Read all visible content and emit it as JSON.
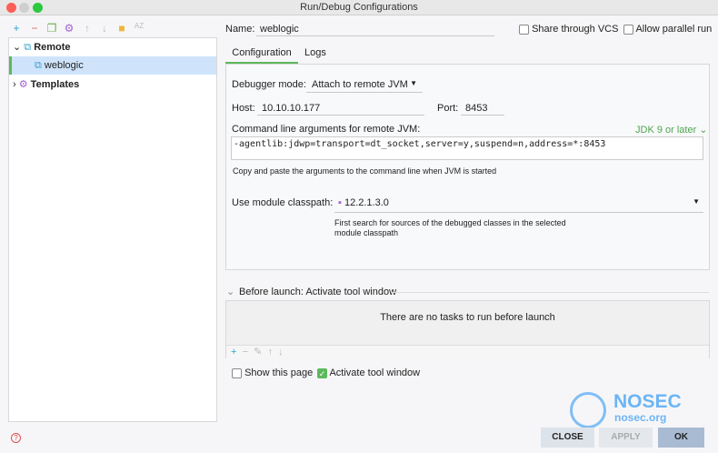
{
  "window": {
    "title": "Run/Debug Configurations"
  },
  "toolbar": {
    "icons": [
      "add-icon",
      "remove-icon",
      "copy-icon",
      "gear-icon",
      "arrow-up-icon",
      "arrow-down-icon",
      "folder-add-icon",
      "sort-az-icon"
    ]
  },
  "tree": {
    "items": [
      {
        "label": "Remote"
      },
      {
        "label": "weblogic"
      },
      {
        "label": "Templates"
      }
    ]
  },
  "form": {
    "name_label": "Name:",
    "name_value": "weblogic",
    "share_vcs": "Share through VCS",
    "allow_parallel": "Allow parallel run",
    "tabs": [
      "Configuration",
      "Logs"
    ],
    "debugger_mode_label": "Debugger mode:",
    "debugger_mode_value": "Attach to remote JVM",
    "host_label": "Host:",
    "host_value": "10.10.10.177",
    "port_label": "Port:",
    "port_value": "8453",
    "cmd_label": "Command line arguments for remote JVM:",
    "jdk_link": "JDK 9 or later ⌄",
    "cmd_value": "-agentlib:jdwp=transport=dt_socket,server=y,suspend=n,address=*:8453",
    "cmd_hint": "Copy and paste the arguments to the command line when JVM is started",
    "module_label": "Use module classpath:",
    "module_value": "12.2.1.3.0",
    "module_hint1": "First search for sources of the debugged classes in the selected",
    "module_hint2": "module classpath"
  },
  "before_launch": {
    "title": "Before launch: Activate tool window",
    "empty": "There are no tasks to run before launch"
  },
  "options": {
    "show_page": "Show this page",
    "activate_tool": "Activate tool window",
    "show_page_checked": false,
    "activate_tool_checked": true
  },
  "watermark": {
    "brand": "NOSEC",
    "site": "nosec.org"
  },
  "buttons": {
    "close": "CLOSE",
    "apply": "APPLY",
    "ok": "OK"
  },
  "colors": {
    "accent": "#5cb85c",
    "link": "#4fa64f",
    "selection": "#cfe4fb"
  }
}
